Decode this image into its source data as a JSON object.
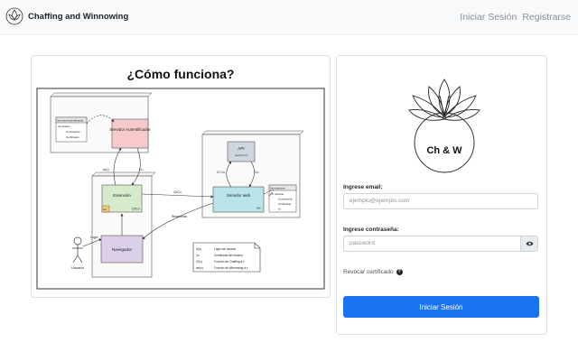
{
  "navbar": {
    "brand": "Chaffing and Winnowing",
    "login_link": "Iniciar Sesión",
    "register_link": "Registrarse"
  },
  "diagram": {
    "title": "¿Cómo funciona?",
    "nodes": {
      "server_auth": "Servidor Autentificador",
      "extension": "Extensión",
      "server_web": "Servidor web",
      "api": "API",
      "api_sub": "ver(Cf,Cv)",
      "browser": "Navegador",
      "user": "Usuario"
    },
    "tables": {
      "auth_db_title": "ServidorAutentificador",
      "auth_db_rows": [
        "Id  Usuario",
        "Contraseña",
        "Certificado"
      ],
      "web_db_title": "Servidorweb",
      "web_db_rows": [
        "PK  Usuario",
        "Contraseña",
        "Certificado",
        "Id"
      ]
    },
    "edge_labels": {
      "a_u": "A(u)",
      "c_u_left": "Cu",
      "cf_cv_ext": "Cf/Cv",
      "cf_cv_arrow": "Cf/Cv",
      "c_cu": "Cf Cu",
      "c_u_right": "Cu",
      "login": "Login",
      "respuesta": "Respuesta",
      "ext_tag": "Ao",
      "web_tag": "Wa"
    },
    "legend": [
      {
        "key": "A(u)",
        "desc": "Login del usuario"
      },
      {
        "key": "Cu",
        "desc": "Certificado del usuario"
      },
      {
        "key": "Cf(x)",
        "desc": "Función de Chaffing a x"
      },
      {
        "key": "wn(x)",
        "desc": "Función de Winnowing a x"
      }
    ]
  },
  "login_form": {
    "logo_text": "Ch & W",
    "email_label": "Ingrese email:",
    "email_placeholder": "ejemplo@ejemplo.com",
    "password_label": "Ingrese contraseña:",
    "password_placeholder": "password",
    "revoke_link": "Revocar certificado",
    "submit_label": "Iniciar Sesión"
  },
  "colors": {
    "primary": "#1a73f0",
    "auth_box": "#f8c9cb",
    "extension_box": "#d5ebcc",
    "web_box": "#b8e4ea",
    "api_box": "#cfd6e0",
    "browser_box": "#dbd0e8"
  }
}
